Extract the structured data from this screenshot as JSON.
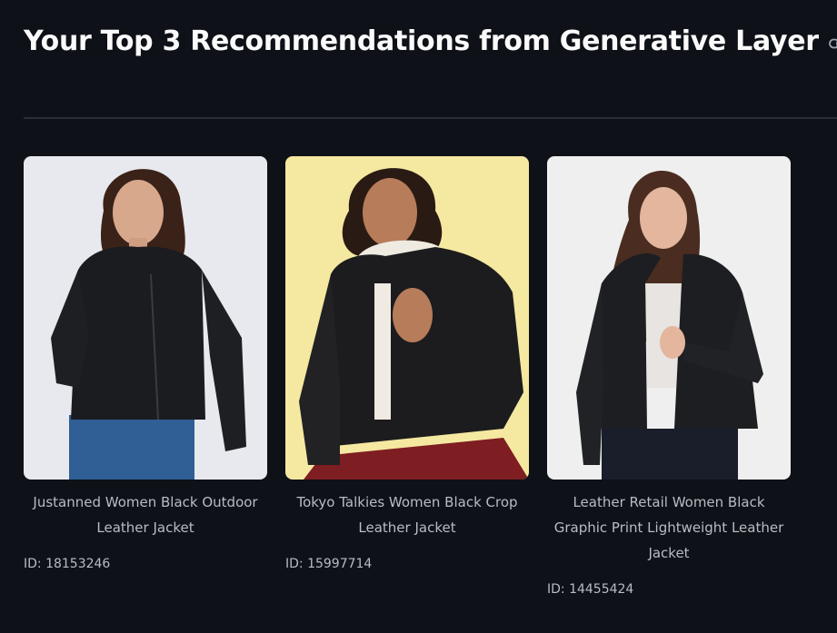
{
  "header": {
    "title": "Your Top 3 Recommendations from Generative Layer",
    "anchor_icon": "link-icon"
  },
  "products": [
    {
      "name": "Justanned Women Black Outdoor Leather Jacket",
      "id_label": "ID: 18153246",
      "image_bg": "#e9eaef"
    },
    {
      "name": "Tokyo Talkies Women Black Crop Leather Jacket",
      "id_label": "ID: 15997714",
      "image_bg": "#f6e9a2"
    },
    {
      "name": "Leather Retail Women Black Graphic Print Lightweight Leather Jacket",
      "id_label": "ID: 14455424",
      "image_bg": "#efefef"
    }
  ]
}
